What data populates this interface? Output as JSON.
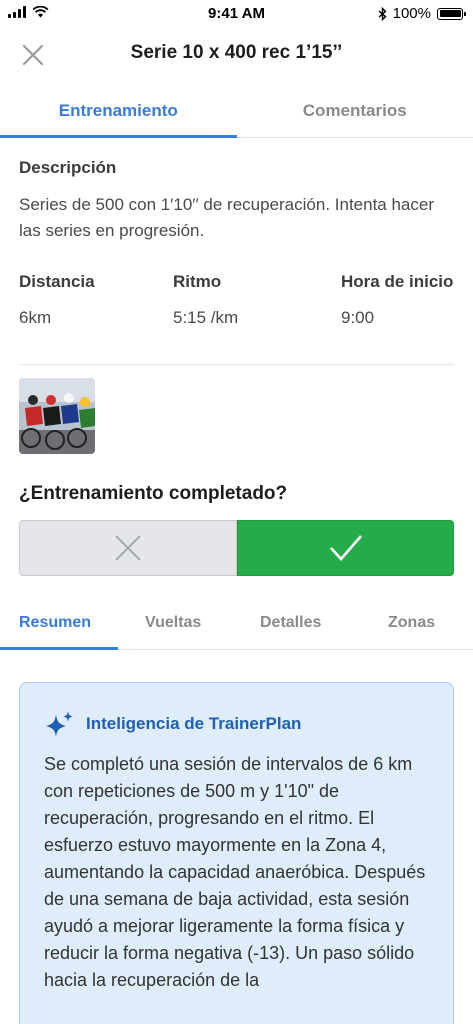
{
  "status_bar": {
    "time": "9:41 AM",
    "battery": "100%"
  },
  "header": {
    "title": "Serie 10 x 400 rec 1’15’’"
  },
  "top_tabs": [
    {
      "label": "Entrenamiento",
      "active": true
    },
    {
      "label": "Comentarios",
      "active": false
    }
  ],
  "description": {
    "title": "Descripción",
    "text": "Series de 500 con 1′10′′ de recuperación. Intenta hacer las series en progresión."
  },
  "stats": [
    {
      "label": "Distancia",
      "value": "6km"
    },
    {
      "label": "Ritmo",
      "value": "5:15 /km"
    },
    {
      "label": "Hora de inicio",
      "value": "9:00"
    }
  ],
  "completion": {
    "question": "¿Entrenamiento completado?",
    "selected": "yes"
  },
  "sub_tabs": [
    {
      "label": "Resumen",
      "active": true
    },
    {
      "label": "Vueltas",
      "active": false
    },
    {
      "label": "Detalles",
      "active": false
    },
    {
      "label": "Zonas",
      "active": false
    }
  ],
  "ai_summary": {
    "title": "Inteligencia de TrainerPlan",
    "text": "Se completó una sesión de intervalos de 6 km con repeticiones de 500 m y 1'10\" de recuperación, progresando en el ritmo. El esfuerzo estuvo mayormente en la Zona 4, aumentando la capacidad anaeróbica. Después de una semana de baja actividad, esta sesión ayudó a mejorar ligeramente la forma física y reducir la forma negativa (-13). Un paso sólido hacia la recuperación de la"
  },
  "colors": {
    "accent": "#3a7bd5",
    "success": "#23ac47",
    "ai_background": "#deedf9",
    "ai_title": "#1f5fb5"
  },
  "icons": {
    "close": "close-icon",
    "toggle_no": "x-icon",
    "toggle_yes": "check-icon",
    "ai": "sparkle-icon"
  }
}
